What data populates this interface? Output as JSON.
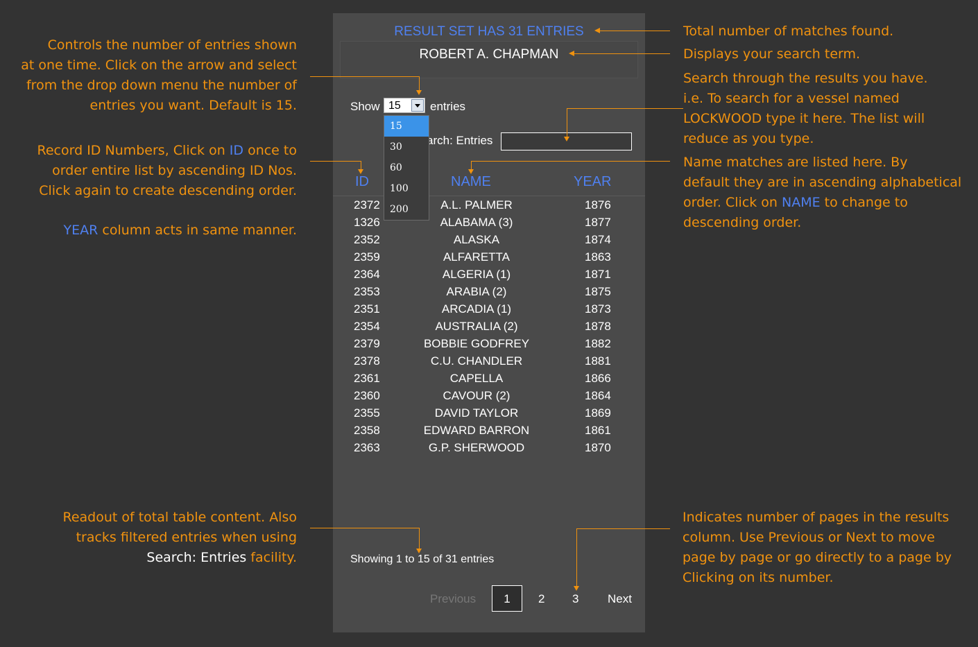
{
  "panel": {
    "result_title": "RESULT SET HAS 31 ENTRIES",
    "search_term": "ROBERT A. CHAPMAN",
    "show_label": "Show",
    "show_value": "15",
    "entries_label": "entries",
    "page_size_options": [
      "15",
      "30",
      "60",
      "100",
      "200"
    ],
    "search_label": "Search: Entries",
    "search_visible_fragment": "arch: Entries",
    "search_value": "",
    "columns": {
      "id": "ID",
      "name": "NAME",
      "year": "YEAR"
    },
    "rows": [
      {
        "id": "2372",
        "name": "A.L. PALMER",
        "year": "1876"
      },
      {
        "id": "1326",
        "name": "ALABAMA (3)",
        "year": "1877"
      },
      {
        "id": "2352",
        "name": "ALASKA",
        "year": "1874"
      },
      {
        "id": "2359",
        "name": "ALFARETTA",
        "year": "1863"
      },
      {
        "id": "2364",
        "name": "ALGERIA (1)",
        "year": "1871"
      },
      {
        "id": "2353",
        "name": "ARABIA (2)",
        "year": "1875"
      },
      {
        "id": "2351",
        "name": "ARCADIA (1)",
        "year": "1873"
      },
      {
        "id": "2354",
        "name": "AUSTRALIA (2)",
        "year": "1878"
      },
      {
        "id": "2379",
        "name": "BOBBIE GODFREY",
        "year": "1882"
      },
      {
        "id": "2378",
        "name": "C.U. CHANDLER",
        "year": "1881"
      },
      {
        "id": "2361",
        "name": "CAPELLA",
        "year": "1866"
      },
      {
        "id": "2360",
        "name": "CAVOUR (2)",
        "year": "1864"
      },
      {
        "id": "2355",
        "name": "DAVID TAYLOR",
        "year": "1869"
      },
      {
        "id": "2358",
        "name": "EDWARD BARRON",
        "year": "1861"
      },
      {
        "id": "2363",
        "name": "G.P. SHERWOOD",
        "year": "1870"
      }
    ],
    "info": "Showing 1 to 15 of 31 entries",
    "pagination": {
      "previous": "Previous",
      "pages": [
        "1",
        "2",
        "3"
      ],
      "current": "1",
      "next": "Next"
    }
  },
  "annotations": {
    "entries_control": [
      "Controls the number of entries shown",
      "at one time. Click on the arrow and select",
      "from the drop down menu the number of",
      "entries you want. Default is 15."
    ],
    "id_column": {
      "line1_pre": "Record ID Numbers, Click on ",
      "line1_hl": "ID",
      "line1_post": " once to",
      "line2": "order entire list by ascending ID Nos.",
      "line3": "Click again to create descending order."
    },
    "year_column": {
      "hl": "YEAR",
      "rest": " column acts in same manner."
    },
    "readout": {
      "line1": "Readout of total table content. Also",
      "line2": "tracks filtered entries when using",
      "line3_white": "Search: Entries",
      "line3_rest": " facility."
    },
    "total": "Total number of matches found.",
    "search_term": "Displays your search term.",
    "search_box": [
      "Search through the results you have.",
      "i.e. To search for a vessel named",
      "LOCKWOOD type it here. The list will",
      "reduce as you type."
    ],
    "name_column": {
      "line1": "Name matches are listed here. By",
      "line2": "default they are in ascending alphabetical",
      "line3_pre": "order. Click on ",
      "line3_hl": "NAME",
      "line3_post": " to change to",
      "line4": "descending order."
    },
    "pages": [
      "Indicates number of pages in the results",
      "column. Use Previous or Next to move",
      "page by page or go directly to a page by",
      "Clicking on its number."
    ]
  },
  "colors": {
    "background": "#333333",
    "panel": "#4a4a4a",
    "accent_orange": "#f0920f",
    "accent_blue": "#4f80f0",
    "selected_option": "#3b93e8"
  }
}
